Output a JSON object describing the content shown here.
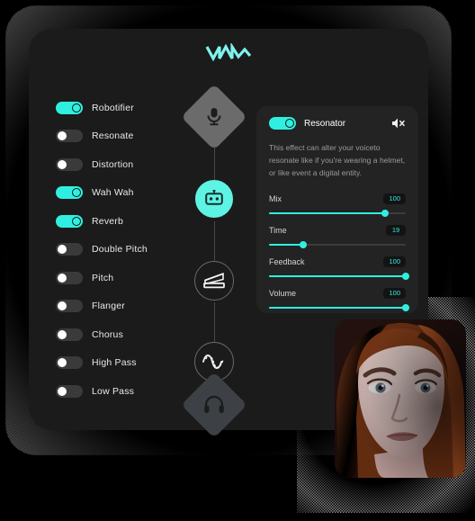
{
  "app": {
    "logo_name": "voicemod-logo",
    "brand_color": "#2ff0e0"
  },
  "effects": {
    "items": [
      {
        "label": "Robotifier",
        "enabled": true
      },
      {
        "label": "Resonate",
        "enabled": false
      },
      {
        "label": "Distortion",
        "enabled": false
      },
      {
        "label": "Wah Wah",
        "enabled": true
      },
      {
        "label": "Reverb",
        "enabled": true
      },
      {
        "label": "Double Pitch",
        "enabled": false
      },
      {
        "label": "Pitch",
        "enabled": false
      },
      {
        "label": "Flanger",
        "enabled": false
      },
      {
        "label": "Chorus",
        "enabled": false
      },
      {
        "label": "High Pass",
        "enabled": false
      },
      {
        "label": "Low Pass",
        "enabled": false
      }
    ]
  },
  "chain": {
    "nodes": [
      {
        "icon": "microphone-icon",
        "shape": "diamond",
        "state": "input"
      },
      {
        "icon": "robot-icon",
        "shape": "circle",
        "state": "active"
      },
      {
        "icon": "wah-pedal-icon",
        "shape": "circle",
        "state": "idle"
      },
      {
        "icon": "waveform-icon",
        "shape": "circle",
        "state": "idle"
      },
      {
        "icon": "headphones-icon",
        "shape": "diamond",
        "state": "output"
      }
    ]
  },
  "panel": {
    "title": "Resonator",
    "enabled": true,
    "mute_icon": "speaker-mute-icon",
    "description": "This effect can alter your voiceto resonate like if you're wearing a helmet, or like event a digital entity.",
    "sliders": [
      {
        "name": "Mix",
        "value": "100",
        "percent": 85
      },
      {
        "name": "Time",
        "value": "19",
        "percent": 25
      },
      {
        "name": "Feedback",
        "value": "100",
        "percent": 100
      },
      {
        "name": "Volume",
        "value": "100",
        "percent": 100
      }
    ]
  },
  "video": {
    "label": "webcam-preview"
  }
}
